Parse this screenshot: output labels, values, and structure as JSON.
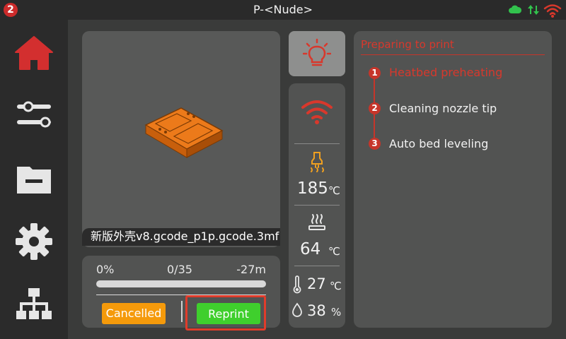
{
  "status_bar": {
    "notification_count": "2",
    "printer_name": "P-<Nude>",
    "icons": [
      "cloud-icon",
      "transfer-icon",
      "wifi-icon"
    ]
  },
  "sidebar": {
    "items": [
      {
        "name": "home",
        "icon": "home-icon",
        "active": true
      },
      {
        "name": "controls",
        "icon": "sliders-icon"
      },
      {
        "name": "files",
        "icon": "folder-icon"
      },
      {
        "name": "settings",
        "icon": "gear-icon"
      },
      {
        "name": "network",
        "icon": "network-icon"
      }
    ]
  },
  "preview": {
    "filename": "新版外壳v8.gcode_p1p.gcode.3mf"
  },
  "progress": {
    "percent_label": "0%",
    "layers_label": "0/35",
    "remaining_label": "-27m",
    "value": 0,
    "cancelled_label": "Cancelled",
    "reprint_label": "Reprint"
  },
  "sensors": {
    "nozzle_temp": "185",
    "nozzle_unit": "℃",
    "bed_temp": "64",
    "bed_unit": "℃",
    "chamber_temp": "27",
    "chamber_unit": "℃",
    "humidity": "38",
    "humidity_unit": "%"
  },
  "steps": {
    "title": "Preparing to print",
    "items": [
      {
        "num": "1",
        "label": "Heatbed preheating",
        "active": true
      },
      {
        "num": "2",
        "label": "Cleaning nozzle tip",
        "active": false
      },
      {
        "num": "3",
        "label": "Auto bed leveling",
        "active": false
      }
    ]
  },
  "colors": {
    "accent_red": "#c6352a",
    "cancel_orange": "#f59a0b",
    "reprint_green": "#3fcf2d",
    "cloud_green": "#32c24d"
  }
}
